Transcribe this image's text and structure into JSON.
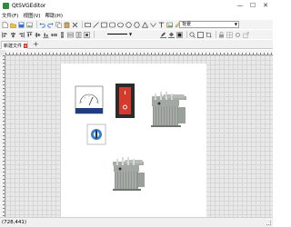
{
  "window": {
    "title": "QtSVGEditor",
    "minimize": "—",
    "maximize": "☐",
    "close": "✕"
  },
  "menu": [
    "文件(F)",
    "视图(V)",
    "帮助(H)"
  ],
  "toolbar": {
    "layer_combo": "背景"
  },
  "tabs": {
    "active": "新建文件",
    "close": "×",
    "add": "+"
  },
  "status": {
    "coords": "(728,441)"
  },
  "colors": {
    "switch_red": "#d63a2a",
    "switch_dark": "#2b2b2b",
    "meter_blue": "#1f3d82",
    "knob_blue": "#2f7fd8",
    "transformer_gray": "#8f948f",
    "page_bg": "#ffffff",
    "grid_bg": "#e9e9e9"
  },
  "canvas": {
    "elements": [
      "analog-meter",
      "red-rocker-switch",
      "power-transformer-1",
      "rotary-switch",
      "power-transformer-2"
    ]
  }
}
